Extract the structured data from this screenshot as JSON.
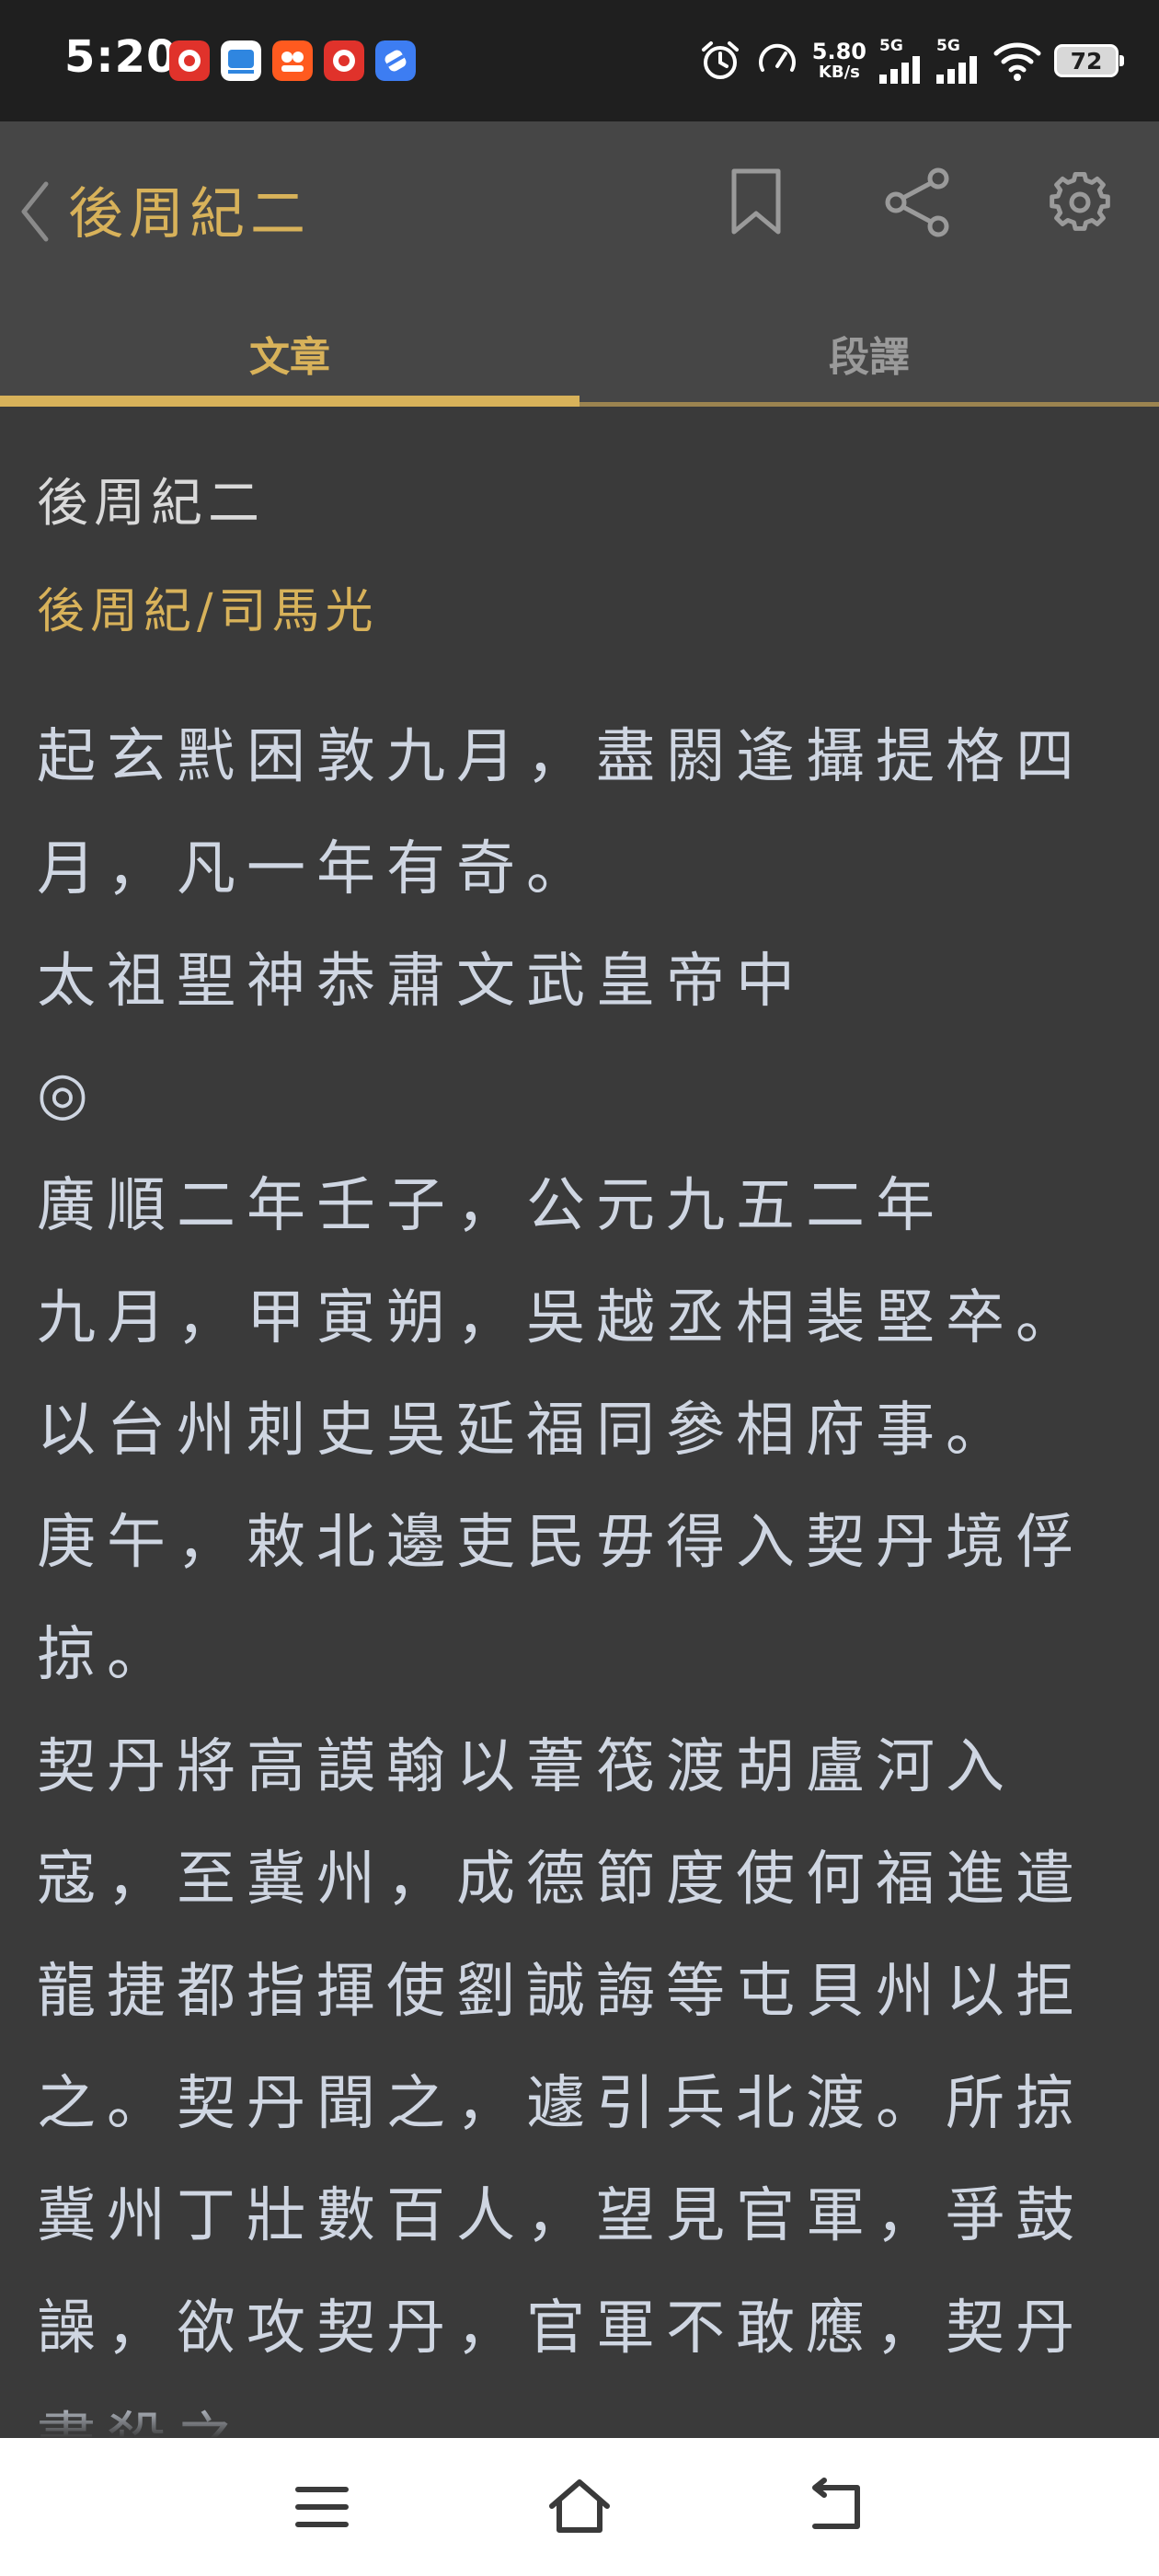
{
  "status_bar": {
    "time": "5:20",
    "net_speed_value": "5.80",
    "net_speed_unit": "KB/s",
    "signal_1_label": "5G",
    "signal_2_label": "5G",
    "battery": "72"
  },
  "header": {
    "title": "後周紀二"
  },
  "tabs": [
    {
      "label": "文章",
      "active": true
    },
    {
      "label": "段譯",
      "active": false
    }
  ],
  "article": {
    "title": "後周紀二",
    "author": "後周紀/司馬光",
    "paragraphs": [
      "起玄黓困敦九月，盡閼逢攝提格四月，凡一年有奇。",
      "太祖聖神恭肅文武皇帝中",
      "◎",
      "廣順二年壬子，公元九五二年",
      "九月，甲寅朔，吳越丞相裴堅卒。",
      "以台州刺史吳延福同參相府事。",
      "庚午，敕北邊吏民毋得入契丹境俘掠。",
      "契丹將高謨翰以葦筏渡胡盧河入寇，至冀州，成德節度使何福進遣龍捷都指揮使劉誠誨等屯貝州以拒之。契丹聞之，遽引兵北渡。所掠冀州丁壯數百人，望見官軍，爭鼓譟，欲攻契丹，官軍不敢應，契丹盡殺之。"
    ]
  },
  "colors": {
    "accent": "#d8b25a",
    "background": "#3a3a3a",
    "header_bg": "#464646",
    "text": "#cfd6e2"
  }
}
